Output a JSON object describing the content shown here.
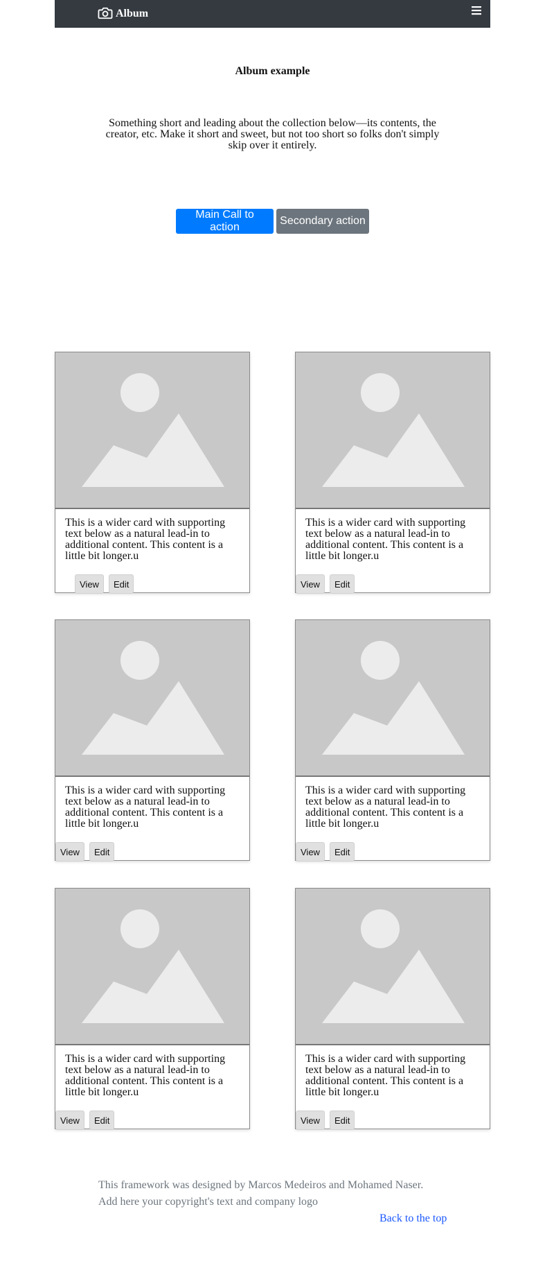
{
  "navbar": {
    "brand": "Album",
    "brand_icon": "camera-icon",
    "menu_icon": "hamburger-menu-icon",
    "background": "#343a40"
  },
  "hero": {
    "title": "Album example",
    "lead": "Something short and leading about the collection below—its contents, the creator, etc. Make it short and sweet, but not too short so folks don't simply skip over it entirely.",
    "primary_action": "Main Call to action",
    "secondary_action": "Secondary action",
    "primary_color": "#007bff",
    "secondary_color": "#6c757d"
  },
  "cards": [
    {
      "image_icon": "image-placeholder-icon",
      "text": "This is a wider card with supporting text below as a natural lead-in to additional content. This content is a little bit longer.u",
      "view_label": "View",
      "edit_label": "Edit"
    },
    {
      "image_icon": "image-placeholder-icon",
      "text": "This is a wider card with supporting text below as a natural lead-in to additional content. This content is a little bit longer.u",
      "view_label": "View",
      "edit_label": "Edit"
    },
    {
      "image_icon": "image-placeholder-icon",
      "text": "This is a wider card with supporting text below as a natural lead-in to additional content. This content is a little bit longer.u",
      "view_label": "View",
      "edit_label": "Edit"
    },
    {
      "image_icon": "image-placeholder-icon",
      "text": "This is a wider card with supporting text below as a natural lead-in to additional content. This content is a little bit longer.u",
      "view_label": "View",
      "edit_label": "Edit"
    },
    {
      "image_icon": "image-placeholder-icon",
      "text": "This is a wider card with supporting text below as a natural lead-in to additional content. This content is a little bit longer.u",
      "view_label": "View",
      "edit_label": "Edit"
    },
    {
      "image_icon": "image-placeholder-icon",
      "text": "This is a wider card with supporting text below as a natural lead-in to additional content. This content is a little bit longer.u",
      "view_label": "View",
      "edit_label": "Edit"
    }
  ],
  "footer": {
    "line1": "This framework was designed by Marcos Medeiros and Mohamed Naser.",
    "line2": "Add here your copyright's text and company logo",
    "back_to_top": "Back to the top",
    "link_color": "#1a57ff"
  }
}
